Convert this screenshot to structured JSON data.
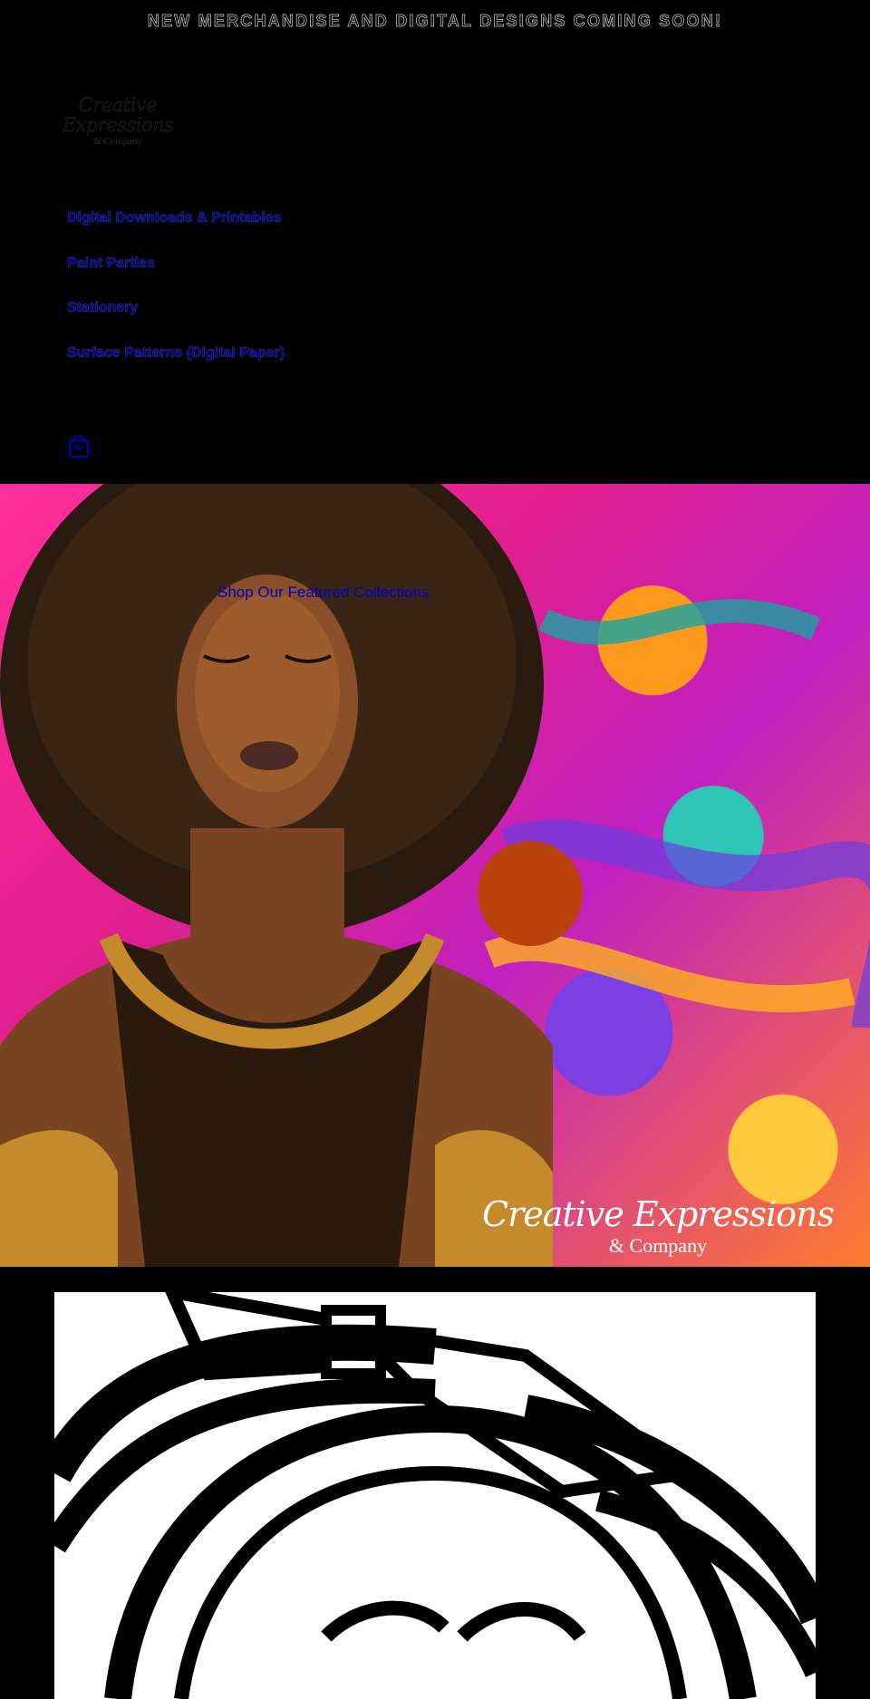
{
  "announcement": {
    "text": "NEW MERCHANDISE AND DIGITAL DESIGNS COMING SOON!"
  },
  "logo": {
    "line1": "Creative Expressions",
    "line2": "& Company"
  },
  "nav": {
    "items": [
      {
        "label": "Digital Downloads & Printables"
      },
      {
        "label": "Paint Parties"
      },
      {
        "label": "Stationery"
      },
      {
        "label": "Surface Patterns (Digital Paper)"
      }
    ]
  },
  "cart": {
    "icon": "shopping-bag-icon",
    "color": "#0000cc"
  },
  "hero": {
    "link": "Shop Our Featured Collections",
    "watermark_line1": "Creative Expressions",
    "watermark_line2": "& Company"
  },
  "colors": {
    "background": "#000000",
    "nav_link": "#00008b",
    "accent_orange": "#b8420a"
  }
}
